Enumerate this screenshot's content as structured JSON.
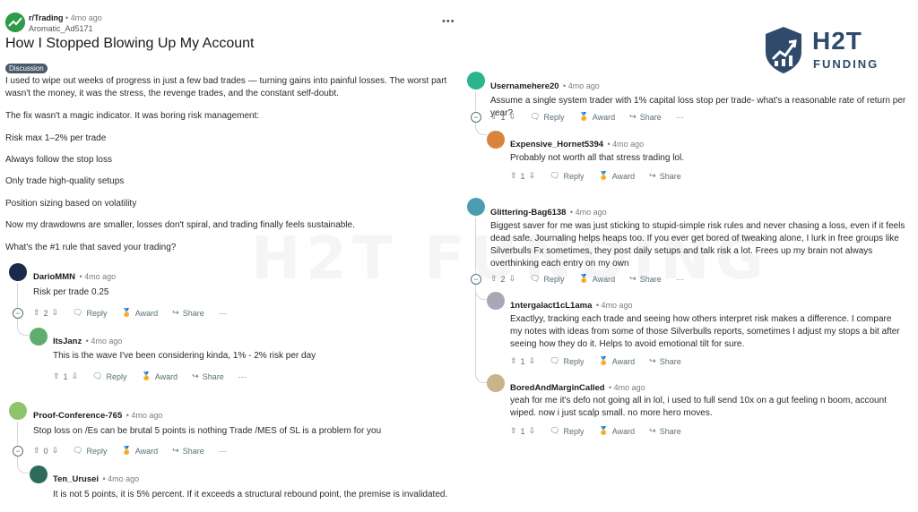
{
  "post": {
    "subreddit": "r/Trading",
    "time": "4mo ago",
    "author": "Aromatic_Ad5171",
    "title": "How I Stopped Blowing Up My Account",
    "flair": "Discussion",
    "paragraphs": [
      "I used to wipe out weeks of progress in just a few bad trades — turning gains into painful losses. The worst part wasn't the money, it was the stress, the revenge trades, and the constant self-doubt.",
      "The fix wasn't a magic indicator. It was boring risk management:",
      "Risk max 1–2% per trade",
      "Always follow the stop loss",
      "Only trade high-quality setups",
      "Position sizing based on volatility",
      "Now my drawdowns are smaller, losses don't spiral, and trading finally feels sustainable.",
      "What's the #1 rule that saved your trading?"
    ],
    "more_icon": "more-icon"
  },
  "labels": {
    "reply": "Reply",
    "award": "Award",
    "share": "Share"
  },
  "brand": {
    "name_line1": "H2T",
    "name_line2": "FUNDING",
    "color": "#2f4a6a",
    "watermark": "H2T FUNDING"
  },
  "comments": {
    "c1": {
      "author": "DarioMMN",
      "time": "4mo ago",
      "text": "Risk per trade 0.25",
      "votes": "2"
    },
    "c1r": {
      "author": "ItsJanz",
      "time": "4mo ago",
      "text": "This is the wave I've been considering kinda, 1% - 2% risk per day",
      "votes": "1"
    },
    "c2": {
      "author": "Proof-Conference-765",
      "time": "4mo ago",
      "text": "Stop loss on /Es can be brutal 5 points is nothing Trade /MES of SL is a problem for you",
      "votes": "0"
    },
    "c2r": {
      "author": "Ten_Urusei",
      "time": "4mo ago",
      "text": "It is not 5 points, it is 5% percent. If it exceeds a structural rebound point, the premise is invalidated."
    },
    "c3": {
      "author": "Usernamehere20",
      "time": "4mo ago",
      "text": "Assume a single system trader with 1% capital loss stop per trade- what's a reasonable rate of return per year?",
      "votes": "1"
    },
    "c3r": {
      "author": "Expensive_Hornet5394",
      "time": "4mo ago",
      "text": "Probably not worth all that stress trading lol.",
      "votes": "1"
    },
    "c4": {
      "author": "Glittering-Bag6138",
      "time": "4mo ago",
      "text": "Biggest saver for me was just sticking to stupid-simple risk rules and never chasing a loss, even if it feels dead safe. Journaling helps heaps too. If you ever get bored of tweaking alone, I lurk in free groups like Silverbulls Fx sometimes, they post daily setups and talk risk a lot. Frees up my brain not always overthinking each entry on my own",
      "votes": "2"
    },
    "c4r1": {
      "author": "1ntergalact1cL1ama",
      "time": "4mo ago",
      "text": "Exactlyy, tracking each trade and seeing how others interpret risk makes a difference. I compare my notes with ideas from some of those Silverbulls reports, sometimes I adjust my stops a bit after seeing how they do it. Helps to avoid emotional tilt for sure.",
      "votes": "1"
    },
    "c4r2": {
      "author": "BoredAndMarginCalled",
      "time": "4mo ago",
      "text": "yeah for me it's defo not going all in lol, i used to full send 10x on a gut feeling n boom, account wiped. now i just scalp small. no more hero moves.",
      "votes": "1"
    }
  }
}
